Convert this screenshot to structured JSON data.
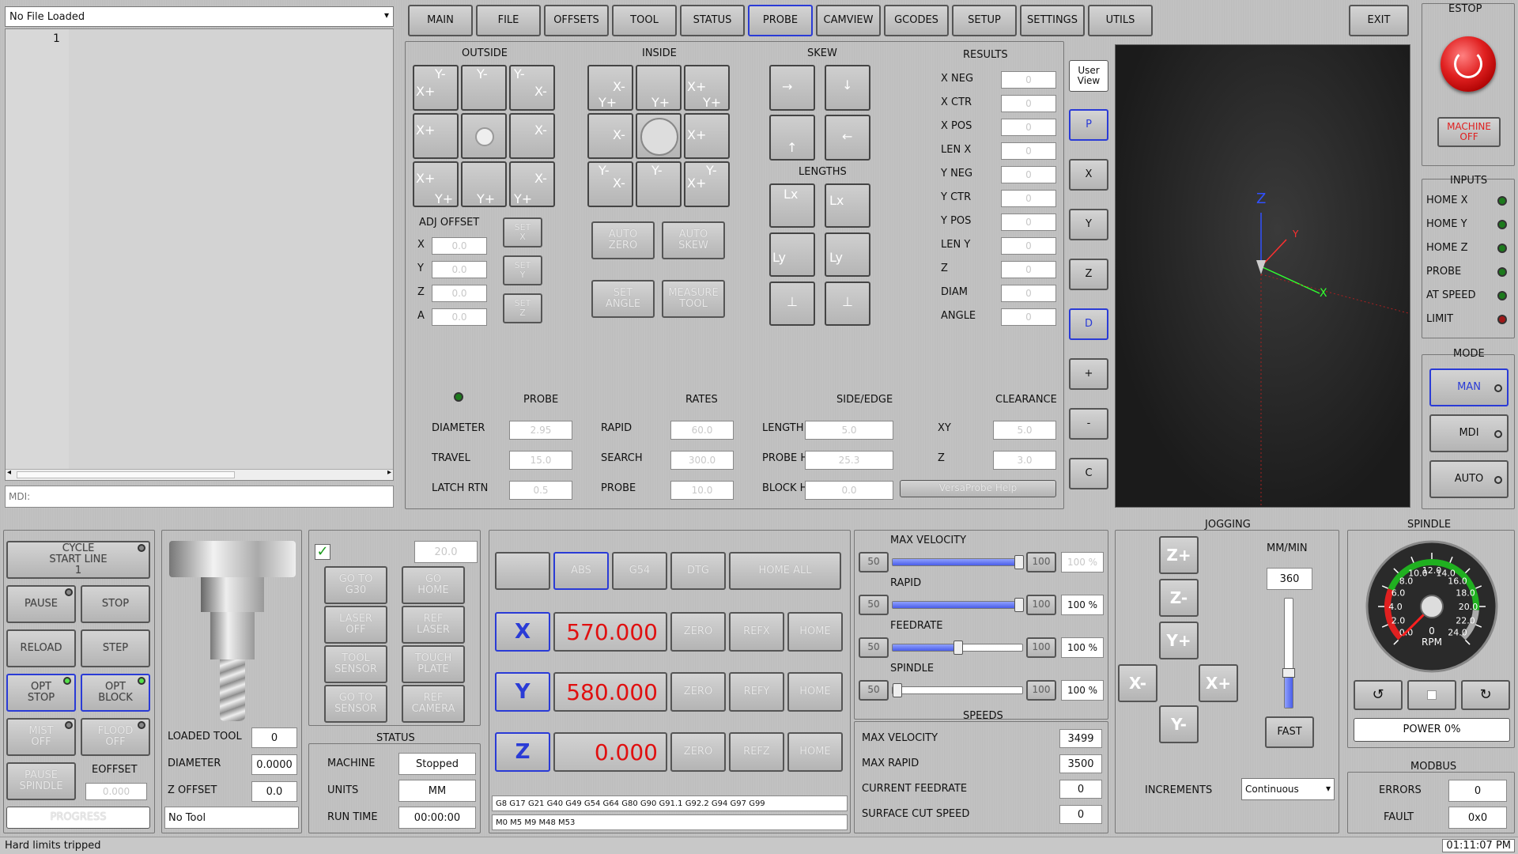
{
  "file": {
    "selector": "No File Loaded",
    "line_number": "1",
    "mdi_placeholder": "MDI:"
  },
  "tabs": [
    "MAIN",
    "FILE",
    "OFFSETS",
    "TOOL",
    "STATUS",
    "PROBE",
    "CAMVIEW",
    "GCODES",
    "SETUP",
    "SETTINGS",
    "UTILS"
  ],
  "exit_label": "EXIT",
  "estop": {
    "title": "ESTOP",
    "machine_off": "MACHINE OFF"
  },
  "inputs": {
    "title": "INPUTS",
    "items": [
      "HOME X",
      "HOME Y",
      "HOME Z",
      "PROBE",
      "AT SPEED",
      "LIMIT"
    ]
  },
  "mode": {
    "title": "MODE",
    "items": [
      "MAN",
      "MDI",
      "AUTO"
    ]
  },
  "probe": {
    "outside": "OUTSIDE",
    "inside": "INSIDE",
    "skew": "SKEW",
    "lengths": "LENGTHS",
    "results_title": "RESULTS",
    "results": [
      {
        "label": "X NEG",
        "value": "0"
      },
      {
        "label": "X CTR",
        "value": "0"
      },
      {
        "label": "X POS",
        "value": "0"
      },
      {
        "label": "LEN X",
        "value": "0"
      },
      {
        "label": "Y NEG",
        "value": "0"
      },
      {
        "label": "Y CTR",
        "value": "0"
      },
      {
        "label": "Y POS",
        "value": "0"
      },
      {
        "label": "LEN Y",
        "value": "0"
      },
      {
        "label": "Z",
        "value": "0"
      },
      {
        "label": "DIAM",
        "value": "0"
      },
      {
        "label": "ANGLE",
        "value": "0"
      }
    ],
    "adj_offset": "ADJ OFFSET",
    "adj": [
      {
        "label": "X",
        "value": "0.0",
        "set": "SET X"
      },
      {
        "label": "Y",
        "value": "0.0",
        "set": "SET Y"
      },
      {
        "label": "Z",
        "value": "0.0",
        "set": "SET Z"
      },
      {
        "label": "A",
        "value": "0.0"
      }
    ],
    "auto_zero": "AUTO ZERO",
    "auto_skew": "AUTO SKEW",
    "set_angle": "SET ANGLE",
    "measure_tool": "MEASURE TOOL",
    "headers": {
      "probe": "PROBE",
      "rates": "RATES",
      "side": "SIDE/EDGE",
      "clearance": "CLEARANCE"
    },
    "rows": [
      {
        "a": "DIAMETER",
        "av": "2.95",
        "b": "RAPID",
        "bv": "60.0",
        "c": "LENGTH",
        "cv": "5.0",
        "d": "XY",
        "dv": "5.0"
      },
      {
        "a": "TRAVEL",
        "av": "15.0",
        "b": "SEARCH",
        "bv": "300.0",
        "c": "PROBE HT",
        "cv": "25.3",
        "d": "Z",
        "dv": "3.0"
      },
      {
        "a": "LATCH RTN",
        "av": "0.5",
        "b": "PROBE",
        "bv": "10.0",
        "c": "BLOCK HT",
        "cv": "0.0"
      }
    ],
    "help": "VersaProbe Help"
  },
  "view": {
    "user_view": "User View",
    "buttons": [
      "P",
      "X",
      "Y",
      "Z",
      "D",
      "+",
      "-",
      "C"
    ],
    "axis_x": "X",
    "axis_y": "Y",
    "axis_z": "Z"
  },
  "controls": {
    "cycle_start": "CYCLE START LINE 1",
    "pause": "PAUSE",
    "stop": "STOP",
    "reload": "RELOAD",
    "step": "STEP",
    "opt_stop": "OPT STOP",
    "opt_block": "OPT BLOCK",
    "mist": "MIST OFF",
    "flood": "FLOOD OFF",
    "pause_spindle": "PAUSE SPINDLE",
    "eoffset": "EOFFSET",
    "eoffset_value": "0.000",
    "progress": "PROGRESS"
  },
  "tool": {
    "loaded_label": "LOADED TOOL",
    "loaded": "0",
    "diam_label": "DIAMETER",
    "diam": "0.0000",
    "zoff_label": "Z OFFSET",
    "zoff": "0.0",
    "name": "No Tool"
  },
  "actions": {
    "value": "20.0",
    "goto_g30": "GO TO G30",
    "go_home": "GO HOME",
    "laser_off": "LASER OFF",
    "ref_laser": "REF LASER",
    "tool_sensor": "TOOL SENSOR",
    "touch_plate": "TOUCH PLATE",
    "goto_sensor": "GO TO SENSOR",
    "ref_camera": "REF CAMERA"
  },
  "status": {
    "title": "STATUS",
    "rows": [
      {
        "label": "MACHINE",
        "value": "Stopped"
      },
      {
        "label": "UNITS",
        "value": "MM"
      },
      {
        "label": "RUN TIME",
        "value": "00:00:00"
      }
    ]
  },
  "dro": {
    "abs": "ABS",
    "g54": "G54",
    "dtg": "DTG",
    "home_all": "HOME ALL",
    "zero": "ZERO",
    "home": "HOME",
    "axes": [
      {
        "axis": "X",
        "value": "570.000",
        "ref": "REFX"
      },
      {
        "axis": "Y",
        "value": "580.000",
        "ref": "REFY"
      },
      {
        "axis": "Z",
        "value": "0.000",
        "ref": "REFZ"
      }
    ],
    "gcodes": "G8 G17 G21 G40 G49 G54 G64 G80 G90 G91.1 G92.2 G94 G97 G99",
    "mcodes": "M0 M5 M9 M48 M53"
  },
  "overrides": {
    "items": [
      {
        "label": "MAX VELOCITY",
        "min": "50",
        "max": "100",
        "value": "100 %",
        "fraction": 1.0,
        "dim": true
      },
      {
        "label": "RAPID",
        "min": "50",
        "max": "100",
        "value": "100 %",
        "fraction": 1.0
      },
      {
        "label": "FEEDRATE",
        "min": "50",
        "max": "100",
        "value": "100 %",
        "fraction": 0.5
      },
      {
        "label": "SPINDLE",
        "min": "50",
        "max": "100",
        "value": "100 %",
        "fraction": 0.0
      }
    ]
  },
  "speeds": {
    "title": "SPEEDS",
    "rows": [
      {
        "label": "MAX VELOCITY",
        "value": "3499"
      },
      {
        "label": "MAX RAPID",
        "value": "3500"
      },
      {
        "label": "CURRENT FEEDRATE",
        "value": "0"
      },
      {
        "label": "SURFACE CUT SPEED",
        "value": "0"
      }
    ]
  },
  "jogging": {
    "title": "JOGGING",
    "units": "MM/MIN",
    "rate": "360",
    "fast": "FAST",
    "increments_label": "INCREMENTS",
    "increments": "Continuous",
    "rate_fraction": 0.3
  },
  "spindle": {
    "title": "SPINDLE",
    "rpm": "0",
    "rpm_label": "RPM",
    "ticks": [
      "0.0",
      "2.0",
      "4.0",
      "6.0",
      "8.0",
      "10.0",
      "12.0",
      "14.0",
      "16.0",
      "18.0",
      "20.0",
      "22.0",
      "24.0"
    ],
    "power": "POWER 0%"
  },
  "modbus": {
    "title": "MODBUS",
    "errors_label": "ERRORS",
    "errors": "0",
    "fault_label": "FAULT",
    "fault": "0x0"
  },
  "statusbar": {
    "message": "Hard limits tripped",
    "clock": "01:11:07 PM"
  },
  "colors": {
    "accent": "#2a3bd6",
    "dro_red": "#e01010",
    "estop": "#e02020"
  }
}
